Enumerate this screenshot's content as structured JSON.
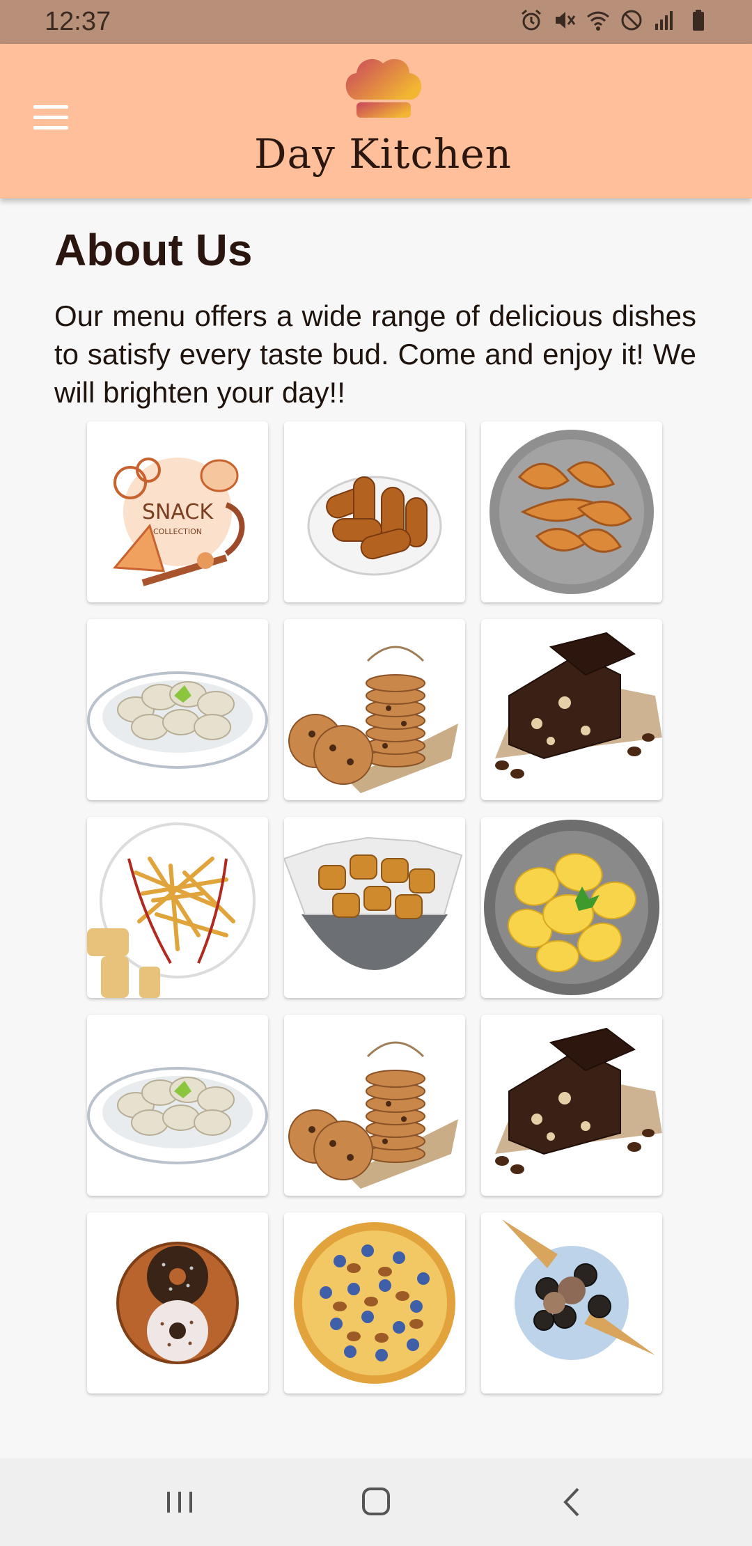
{
  "status_bar": {
    "time": "12:37",
    "icons": [
      "alarm-icon",
      "mute-icon",
      "wifi-icon",
      "do-not-disturb-icon",
      "signal-icon",
      "battery-icon"
    ]
  },
  "app_bar": {
    "brand_name": "Day Kitchen",
    "menu_icon": "hamburger-menu-icon",
    "logo_icon": "chef-hat-icon"
  },
  "about": {
    "title": "About Us",
    "description": "Our menu offers a wide range of delicious dishes to satisfy every taste bud. Come and enjoy it! We will brighten your day!!"
  },
  "gallery": {
    "items": [
      {
        "icon": "snack-collection-image",
        "text": "SNACK",
        "subtext": "COLLECTION"
      },
      {
        "icon": "croquettes-image"
      },
      {
        "icon": "empanadas-image"
      },
      {
        "icon": "dumplings-image"
      },
      {
        "icon": "cookies-stack-image"
      },
      {
        "icon": "brownies-image"
      },
      {
        "icon": "fries-image"
      },
      {
        "icon": "fried-bites-bowl-image"
      },
      {
        "icon": "potato-chips-image"
      },
      {
        "icon": "dumplings-image"
      },
      {
        "icon": "cookies-stack-image"
      },
      {
        "icon": "brownies-image"
      },
      {
        "icon": "donuts-image"
      },
      {
        "icon": "blueberry-walnut-tart-image"
      },
      {
        "icon": "ice-cream-cone-cookies-image"
      }
    ]
  },
  "nav_bar": {
    "icons": [
      "recent-apps-icon",
      "home-icon",
      "back-icon"
    ]
  },
  "colors": {
    "status_bar": "#b8907a",
    "app_bar": "#ffbf9b",
    "text_dark": "#2a160f",
    "background": "#f7f7f7"
  }
}
